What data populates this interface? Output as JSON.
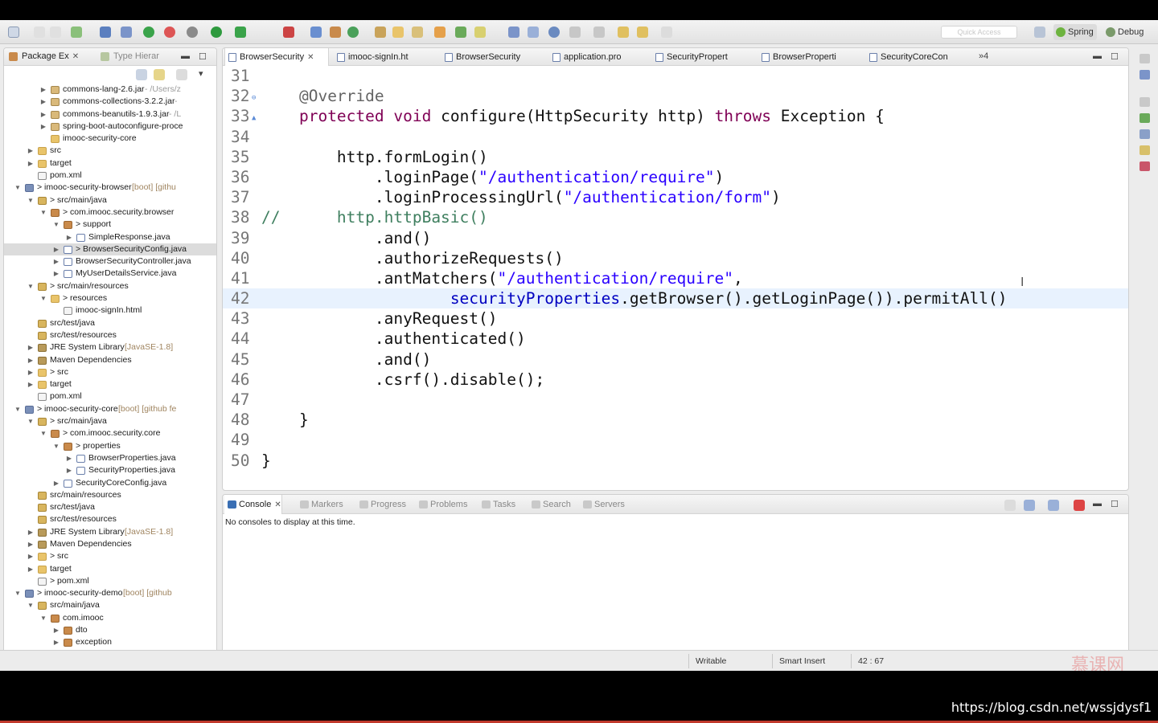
{
  "toolbar": {
    "quick_access_placeholder": "Quick Access",
    "perspectives": [
      {
        "label": "Spring"
      },
      {
        "label": "Debug"
      }
    ]
  },
  "package_explorer": {
    "tabs": [
      {
        "label": "Package Ex"
      },
      {
        "label": "Type Hierar"
      }
    ],
    "tree": [
      {
        "depth": 4,
        "icon": "jar",
        "label": "commons-lang-2.6.jar",
        "suffix": " - /Users/z",
        "arrow": true
      },
      {
        "depth": 4,
        "icon": "jar",
        "label": "commons-collections-3.2.2.jar",
        "suffix": " -",
        "arrow": true
      },
      {
        "depth": 4,
        "icon": "jar",
        "label": "commons-beanutils-1.9.3.jar",
        "suffix": " - /L",
        "arrow": true
      },
      {
        "depth": 4,
        "icon": "jar",
        "label": "spring-boot-autoconfigure-proce",
        "suffix": "",
        "arrow": true
      },
      {
        "depth": 4,
        "icon": "folder",
        "label": "imooc-security-core",
        "suffix": "",
        "arrow": false
      },
      {
        "depth": 3,
        "icon": "folder",
        "label": "src",
        "suffix": "",
        "arrow": true
      },
      {
        "depth": 3,
        "icon": "folder",
        "label": "target",
        "suffix": "",
        "arrow": true
      },
      {
        "depth": 3,
        "icon": "file",
        "label": "pom.xml",
        "suffix": "",
        "arrow": false
      },
      {
        "depth": 2,
        "icon": "proj",
        "label": "> imooc-security-browser",
        "suffix": " [boot] [githu",
        "arrow": true,
        "open": true
      },
      {
        "depth": 3,
        "icon": "srcf",
        "label": "> src/main/java",
        "suffix": "",
        "arrow": true,
        "open": true
      },
      {
        "depth": 4,
        "icon": "pkg",
        "label": "> com.imooc.security.browser",
        "suffix": "",
        "arrow": true,
        "open": true
      },
      {
        "depth": 5,
        "icon": "pkg",
        "label": "> support",
        "suffix": "",
        "arrow": true,
        "open": true
      },
      {
        "depth": 6,
        "icon": "java",
        "label": "SimpleResponse.java",
        "suffix": "",
        "arrow": true
      },
      {
        "depth": 5,
        "icon": "java",
        "label": "> BrowserSecurityConfig.java",
        "suffix": "",
        "arrow": true,
        "selected": true
      },
      {
        "depth": 5,
        "icon": "java",
        "label": "BrowserSecurityController.java",
        "suffix": "",
        "arrow": true
      },
      {
        "depth": 5,
        "icon": "java",
        "label": "MyUserDetailsService.java",
        "suffix": "",
        "arrow": true
      },
      {
        "depth": 3,
        "icon": "srcf",
        "label": "> src/main/resources",
        "suffix": "",
        "arrow": true,
        "open": true
      },
      {
        "depth": 4,
        "icon": "folder",
        "label": "> resources",
        "suffix": "",
        "arrow": true,
        "open": true
      },
      {
        "depth": 5,
        "icon": "file",
        "label": "imooc-signIn.html",
        "suffix": "",
        "arrow": false
      },
      {
        "depth": 3,
        "icon": "srcf",
        "label": "src/test/java",
        "suffix": "",
        "arrow": false
      },
      {
        "depth": 3,
        "icon": "srcf",
        "label": "src/test/resources",
        "suffix": "",
        "arrow": false
      },
      {
        "depth": 3,
        "icon": "lib",
        "label": "JRE System Library",
        "suffix": " [JavaSE-1.8]",
        "arrow": true
      },
      {
        "depth": 3,
        "icon": "lib",
        "label": "Maven Dependencies",
        "suffix": "",
        "arrow": true
      },
      {
        "depth": 3,
        "icon": "folder",
        "label": "> src",
        "suffix": "",
        "arrow": true
      },
      {
        "depth": 3,
        "icon": "folder",
        "label": "target",
        "suffix": "",
        "arrow": true
      },
      {
        "depth": 3,
        "icon": "file",
        "label": "pom.xml",
        "suffix": "",
        "arrow": false
      },
      {
        "depth": 2,
        "icon": "proj",
        "label": "> imooc-security-core",
        "suffix": " [boot] [github fe",
        "arrow": true,
        "open": true
      },
      {
        "depth": 3,
        "icon": "srcf",
        "label": "> src/main/java",
        "suffix": "",
        "arrow": true,
        "open": true
      },
      {
        "depth": 4,
        "icon": "pkg",
        "label": "> com.imooc.security.core",
        "suffix": "",
        "arrow": true,
        "open": true
      },
      {
        "depth": 5,
        "icon": "pkg",
        "label": "> properties",
        "suffix": "",
        "arrow": true,
        "open": true
      },
      {
        "depth": 6,
        "icon": "java",
        "label": "BrowserProperties.java",
        "suffix": "",
        "arrow": true
      },
      {
        "depth": 6,
        "icon": "java",
        "label": "SecurityProperties.java",
        "suffix": "",
        "arrow": true
      },
      {
        "depth": 5,
        "icon": "java",
        "label": "SecurityCoreConfig.java",
        "suffix": "",
        "arrow": true
      },
      {
        "depth": 3,
        "icon": "srcf",
        "label": "src/main/resources",
        "suffix": "",
        "arrow": false
      },
      {
        "depth": 3,
        "icon": "srcf",
        "label": "src/test/java",
        "suffix": "",
        "arrow": false
      },
      {
        "depth": 3,
        "icon": "srcf",
        "label": "src/test/resources",
        "suffix": "",
        "arrow": false
      },
      {
        "depth": 3,
        "icon": "lib",
        "label": "JRE System Library",
        "suffix": " [JavaSE-1.8]",
        "arrow": true
      },
      {
        "depth": 3,
        "icon": "lib",
        "label": "Maven Dependencies",
        "suffix": "",
        "arrow": true
      },
      {
        "depth": 3,
        "icon": "folder",
        "label": "> src",
        "suffix": "",
        "arrow": true
      },
      {
        "depth": 3,
        "icon": "folder",
        "label": "target",
        "suffix": "",
        "arrow": true
      },
      {
        "depth": 3,
        "icon": "file",
        "label": "> pom.xml",
        "suffix": "",
        "arrow": false
      },
      {
        "depth": 2,
        "icon": "proj",
        "label": "> imooc-security-demo",
        "suffix": " [boot] [github",
        "arrow": true,
        "open": true
      },
      {
        "depth": 3,
        "icon": "srcf",
        "label": "src/main/java",
        "suffix": "",
        "arrow": true,
        "open": true
      },
      {
        "depth": 4,
        "icon": "pkg",
        "label": "com.imooc",
        "suffix": "",
        "arrow": true,
        "open": true
      },
      {
        "depth": 5,
        "icon": "pkg",
        "label": "dto",
        "suffix": "",
        "arrow": true
      },
      {
        "depth": 5,
        "icon": "pkg",
        "label": "exception",
        "suffix": "",
        "arrow": true
      }
    ]
  },
  "editor": {
    "tabs": [
      {
        "label": "BrowserSecurity",
        "active": true,
        "closable": true
      },
      {
        "label": "imooc-signIn.ht"
      },
      {
        "label": "BrowserSecurity"
      },
      {
        "label": "application.pro"
      },
      {
        "label": "SecurityPropert"
      },
      {
        "label": "BrowserProperti"
      },
      {
        "label": "SecurityCoreCon"
      }
    ],
    "overflow_label": "»4",
    "lines": [
      {
        "n": "31",
        "tokens": []
      },
      {
        "n": "32",
        "tokens": [
          [
            "",
            "    "
          ],
          [
            "ann",
            "@Override"
          ]
        ],
        "marker": "⊖"
      },
      {
        "n": "33",
        "tokens": [
          [
            "",
            "    "
          ],
          [
            "kw",
            "protected"
          ],
          [
            "",
            " "
          ],
          [
            "kw",
            "void"
          ],
          [
            "",
            " configure(HttpSecurity http) "
          ],
          [
            "kw",
            "throws"
          ],
          [
            "",
            " Exception {"
          ]
        ],
        "marker": "▲"
      },
      {
        "n": "34",
        "tokens": []
      },
      {
        "n": "35",
        "tokens": [
          [
            "",
            "        http.formLogin()"
          ]
        ]
      },
      {
        "n": "36",
        "tokens": [
          [
            "",
            "            .loginPage("
          ],
          [
            "str",
            "\"/authentication/require\""
          ],
          [
            "",
            ")"
          ]
        ]
      },
      {
        "n": "37",
        "tokens": [
          [
            "",
            "            .loginProcessingUrl("
          ],
          [
            "str",
            "\"/authentication/form\""
          ],
          [
            "",
            ")"
          ]
        ]
      },
      {
        "n": "38",
        "tokens": [
          [
            "cmt",
            "//      http.httpBasic()"
          ]
        ]
      },
      {
        "n": "39",
        "tokens": [
          [
            "",
            "            .and()"
          ]
        ]
      },
      {
        "n": "40",
        "tokens": [
          [
            "",
            "            .authorizeRequests()"
          ]
        ]
      },
      {
        "n": "41",
        "tokens": [
          [
            "",
            "            .antMatchers("
          ],
          [
            "str",
            "\"/authentication/require\""
          ],
          [
            "",
            ","
          ]
        ]
      },
      {
        "n": "42",
        "tokens": [
          [
            "",
            "                    "
          ],
          [
            "fld",
            "securityProperties"
          ],
          [
            "",
            ".getBrowser().getLoginPage()).permitAll()"
          ]
        ],
        "current": true
      },
      {
        "n": "43",
        "tokens": [
          [
            "",
            "            .anyRequest()"
          ]
        ]
      },
      {
        "n": "44",
        "tokens": [
          [
            "",
            "            .authenticated()"
          ]
        ]
      },
      {
        "n": "45",
        "tokens": [
          [
            "",
            "            .and()"
          ]
        ]
      },
      {
        "n": "46",
        "tokens": [
          [
            "",
            "            .csrf().disable();"
          ]
        ]
      },
      {
        "n": "47",
        "tokens": []
      },
      {
        "n": "48",
        "tokens": [
          [
            "",
            "    }"
          ]
        ]
      },
      {
        "n": "49",
        "tokens": []
      },
      {
        "n": "50",
        "tokens": [
          [
            "",
            "}"
          ]
        ]
      }
    ]
  },
  "console": {
    "tabs": [
      {
        "label": "Console",
        "active": true
      },
      {
        "label": "Markers"
      },
      {
        "label": "Progress"
      },
      {
        "label": "Problems"
      },
      {
        "label": "Tasks"
      },
      {
        "label": "Search"
      },
      {
        "label": "Servers"
      }
    ],
    "message": "No consoles to display at this time."
  },
  "status_bar": {
    "mode": "Writable",
    "insert_mode": "Smart Insert",
    "position": "42 : 67"
  },
  "watermark": {
    "logo_text": "慕课网",
    "url": "https://blog.csdn.net/wssjdysf1"
  },
  "colors": {
    "keyword": "#7f0055",
    "string": "#2a00ff",
    "field": "#0000c0",
    "comment": "#3f7f5f",
    "current_line": "#e8f2fe"
  }
}
